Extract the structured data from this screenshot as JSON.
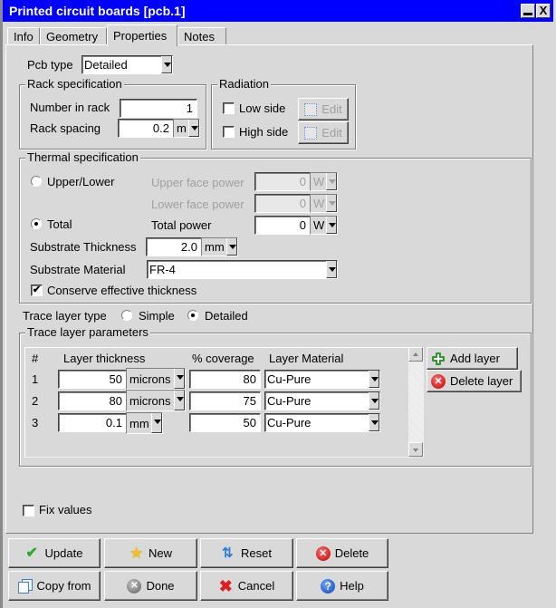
{
  "window": {
    "title": "Printed circuit boards [pcb.1]",
    "minimize_glyph": "_",
    "close_glyph": "X"
  },
  "tabs": [
    {
      "label": "Info",
      "active": false
    },
    {
      "label": "Geometry",
      "active": false
    },
    {
      "label": "Properties",
      "active": true
    },
    {
      "label": "Notes",
      "active": false
    }
  ],
  "pcb_type": {
    "label": "Pcb type",
    "value": "Detailed"
  },
  "rack": {
    "group_label": "Rack specification",
    "number_label": "Number in rack",
    "number_value": "1",
    "spacing_label": "Rack spacing",
    "spacing_value": "0.2",
    "spacing_unit": "m"
  },
  "radiation": {
    "group_label": "Radiation",
    "low_side": {
      "label": "Low side",
      "checked": false,
      "edit_label": "Edit"
    },
    "high_side": {
      "label": "High side",
      "checked": false,
      "edit_label": "Edit"
    }
  },
  "thermal": {
    "group_label": "Thermal specification",
    "upper_lower_label": "Upper/Lower",
    "upper_lower_selected": false,
    "upper_face_label": "Upper face power",
    "upper_face_value": "0",
    "upper_face_unit": "W",
    "lower_face_label": "Lower face power",
    "lower_face_value": "0",
    "lower_face_unit": "W",
    "total_label": "Total",
    "total_selected": true,
    "total_power_label": "Total power",
    "total_power_value": "0",
    "total_power_unit": "W",
    "substrate_thickness_label": "Substrate Thickness",
    "substrate_thickness_value": "2.0",
    "substrate_thickness_unit": "mm",
    "substrate_material_label": "Substrate Material",
    "substrate_material_value": "FR-4",
    "conserve_label": "Conserve effective thickness",
    "conserve_checked": true
  },
  "trace_type": {
    "label": "Trace layer type",
    "simple_label": "Simple",
    "simple_selected": false,
    "detailed_label": "Detailed",
    "detailed_selected": true
  },
  "trace_params": {
    "group_label": "Trace layer parameters",
    "headers": {
      "num": "#",
      "thickness": "Layer thickness",
      "coverage": "% coverage",
      "material": "Layer Material"
    },
    "rows": [
      {
        "num": "1",
        "thickness": "50",
        "unit": "microns",
        "coverage": "80",
        "material": "Cu-Pure"
      },
      {
        "num": "2",
        "thickness": "80",
        "unit": "microns",
        "coverage": "75",
        "material": "Cu-Pure"
      },
      {
        "num": "3",
        "thickness": "0.1",
        "unit": "mm",
        "coverage": "50",
        "material": "Cu-Pure"
      }
    ],
    "add_layer_label": "Add layer",
    "delete_layer_label": "Delete layer"
  },
  "fix_values": {
    "label": "Fix values",
    "checked": false
  },
  "buttons": {
    "update": "Update",
    "new": "New",
    "reset": "Reset",
    "delete": "Delete",
    "copy_from": "Copy from",
    "done": "Done",
    "cancel": "Cancel",
    "help": "Help"
  },
  "colors": {
    "titlebar": "#0000ff",
    "face": "#d9d9d9"
  }
}
